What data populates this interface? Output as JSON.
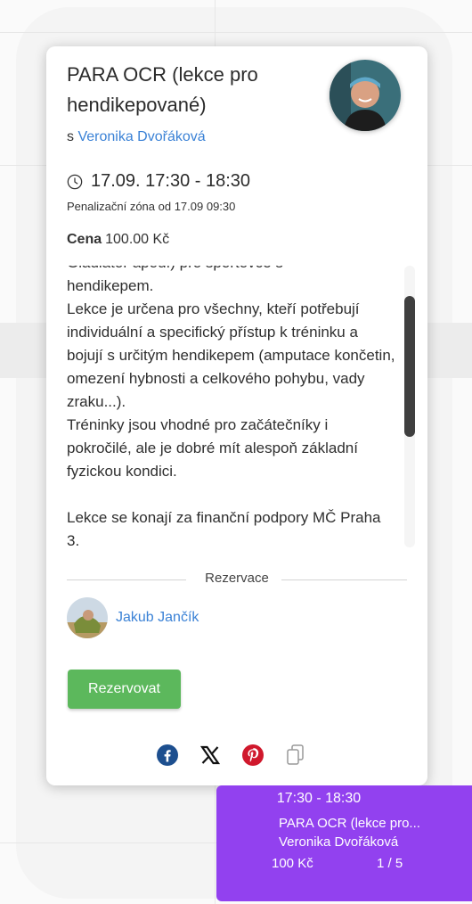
{
  "lesson": {
    "title": "PARA OCR (lekce pro hendikepované)",
    "by_prefix": "s",
    "instructor": "Veronika Dvořáková",
    "datetime": "17.09. 17:30 - 18:30",
    "penalty": "Penalizační zóna od 17.09 09:30",
    "price_label": "Cena",
    "price_value": "100.00 Kč",
    "description": "Gladiator apod.) pro sportovce s\nhendikepem.\nLekce je určena pro všechny, kteří potřebují individuální a specifický přístup k tréninku a bojují s určitým hendikepem (amputace končetin, omezení hybnosti a celkového pohybu, vady zraku...).\nTréninky jsou vhodné pro začátečníky i pokročilé, ale je dobré mít alespoň základní fyzickou kondici.\n\nLekce se konají za finanční podpory MČ Praha 3."
  },
  "reservations": {
    "heading": "Rezervace",
    "users": [
      {
        "name": "Jakub Jančík"
      }
    ]
  },
  "actions": {
    "reserve_label": "Rezervovat"
  },
  "share": {
    "icons": [
      "facebook-icon",
      "x-icon",
      "pinterest-icon",
      "copy-icon"
    ]
  },
  "event_block": {
    "time": "17:30 - 18:30",
    "name": "PARA OCR (lekce pro...",
    "instructor": "Veronika Dvořáková",
    "price": "100 Kč",
    "capacity": "1 / 5"
  },
  "colors": {
    "accent": "#9241ef",
    "link": "#3b82d6",
    "button": "#5cb85c",
    "edit": "#f6a23a"
  }
}
